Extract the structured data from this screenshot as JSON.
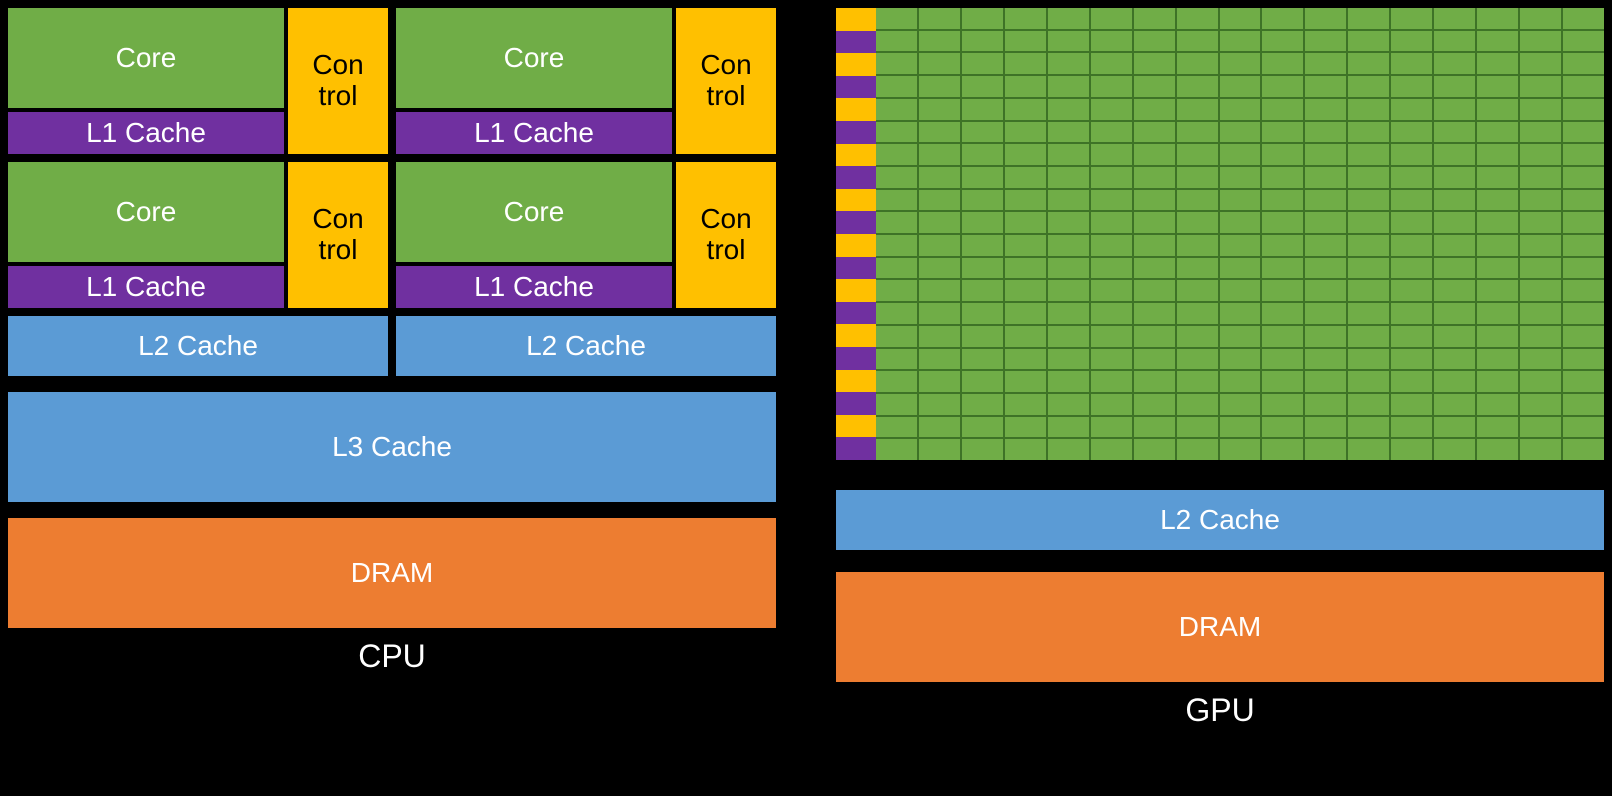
{
  "cpu": {
    "core_label": "Core",
    "control_label": "Con\ntrol",
    "l1_label": "L1 Cache",
    "l2_label": "L2 Cache",
    "l3_label": "L3 Cache",
    "dram_label": "DRAM",
    "title": "CPU"
  },
  "gpu": {
    "l2_label": "L2 Cache",
    "dram_label": "DRAM",
    "title": "GPU",
    "mini_rows": 20,
    "core_cols": 17,
    "core_rows": 20
  },
  "colors": {
    "core": "#70AD47",
    "control": "#FFC000",
    "l1": "#7030A0",
    "l2": "#5B9BD5",
    "l3": "#5B9BD5",
    "dram": "#ED7D31"
  }
}
